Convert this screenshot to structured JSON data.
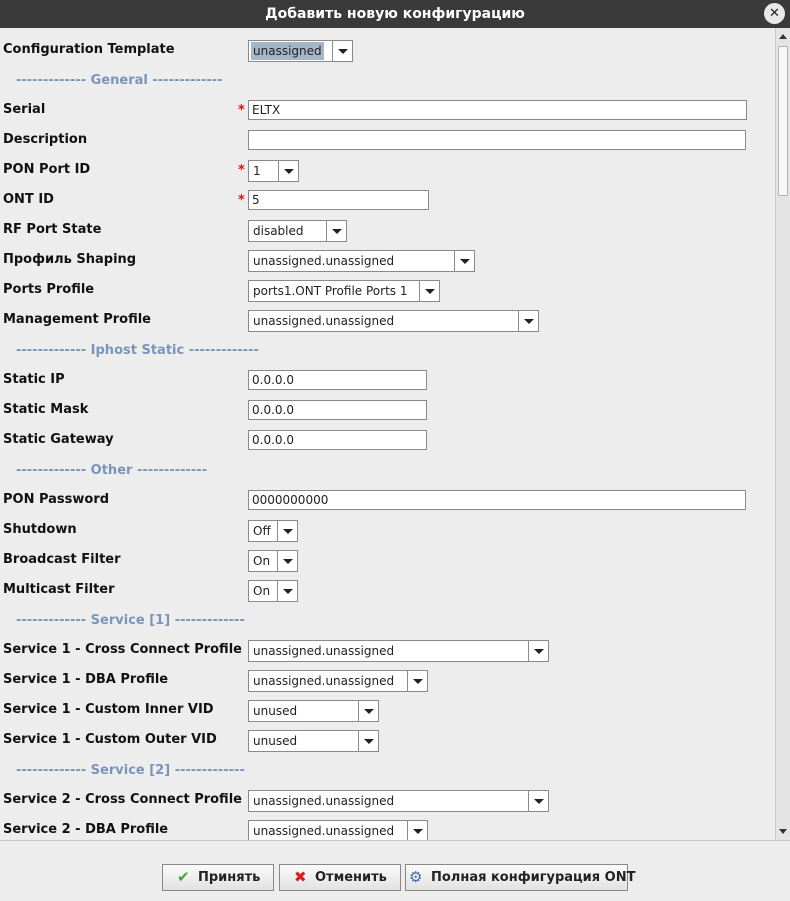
{
  "dialog": {
    "title": "Добавить новую конфигурацию"
  },
  "fields": {
    "template": {
      "label": "Configuration Template",
      "value": "unassigned"
    },
    "sec_general": "------------- General -------------",
    "serial": {
      "label": "Serial",
      "value": "ELTX"
    },
    "description": {
      "label": "Description",
      "value": ""
    },
    "pon_port": {
      "label": "PON Port ID",
      "value": "1"
    },
    "ont_id": {
      "label": "ONT ID",
      "value": "5"
    },
    "rf_port": {
      "label": "RF Port State",
      "value": "disabled"
    },
    "shaping": {
      "label": "Профиль Shaping",
      "value": "unassigned.unassigned"
    },
    "ports_profile": {
      "label": "Ports Profile",
      "value": "ports1.ONT Profile Ports 1"
    },
    "mgmt_profile": {
      "label": "Management Profile",
      "value": "unassigned.unassigned"
    },
    "sec_iphost": "------------- Iphost Static -------------",
    "static_ip": {
      "label": "Static IP",
      "value": "0.0.0.0"
    },
    "static_mask": {
      "label": "Static Mask",
      "value": "0.0.0.0"
    },
    "static_gw": {
      "label": "Static Gateway",
      "value": "0.0.0.0"
    },
    "sec_other": "------------- Other -------------",
    "pon_password": {
      "label": "PON Password",
      "value": "0000000000"
    },
    "shutdown": {
      "label": "Shutdown",
      "value": "Off"
    },
    "broadcast": {
      "label": "Broadcast Filter",
      "value": "On"
    },
    "multicast": {
      "label": "Multicast Filter",
      "value": "On"
    },
    "sec_service1": "------------- Service [1] -------------",
    "s1_cross": {
      "label": "Service 1 - Cross Connect Profile",
      "value": "unassigned.unassigned"
    },
    "s1_dba": {
      "label": "Service 1 - DBA Profile",
      "value": "unassigned.unassigned"
    },
    "s1_inner": {
      "label": "Service 1 - Custom Inner VID",
      "value": "unused"
    },
    "s1_outer": {
      "label": "Service 1 - Custom Outer VID",
      "value": "unused"
    },
    "sec_service2": "------------- Service [2] -------------",
    "s2_cross": {
      "label": "Service 2 - Cross Connect Profile",
      "value": "unassigned.unassigned"
    },
    "s2_dba": {
      "label": "Service 2 - DBA Profile",
      "value": "unassigned.unassigned"
    }
  },
  "required_mark": "*",
  "buttons": {
    "accept": "Принять",
    "cancel": "Отменить",
    "full_config": "Полная конфигурация ONT"
  },
  "icons": {
    "close": "close-icon",
    "accept": "check-icon",
    "cancel": "cross-icon",
    "full_config": "config-icon"
  },
  "colors": {
    "section_header": "#7a95b8",
    "required": "#e01010",
    "selected_value_bg": "#a5b6c8"
  }
}
